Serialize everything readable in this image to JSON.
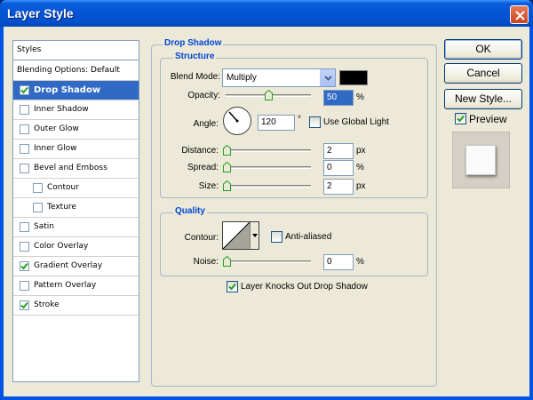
{
  "window": {
    "title": "Layer Style"
  },
  "styles_list": {
    "header": "Styles",
    "blending_label": "Blending Options: Default",
    "items": [
      {
        "label": "Drop Shadow",
        "checked": true,
        "selected": true,
        "indent": false
      },
      {
        "label": "Inner Shadow",
        "checked": false,
        "selected": false,
        "indent": false
      },
      {
        "label": "Outer Glow",
        "checked": false,
        "selected": false,
        "indent": false
      },
      {
        "label": "Inner Glow",
        "checked": false,
        "selected": false,
        "indent": false
      },
      {
        "label": "Bevel and Emboss",
        "checked": false,
        "selected": false,
        "indent": false
      },
      {
        "label": "Contour",
        "checked": false,
        "selected": false,
        "indent": true
      },
      {
        "label": "Texture",
        "checked": false,
        "selected": false,
        "indent": true
      },
      {
        "label": "Satin",
        "checked": false,
        "selected": false,
        "indent": false
      },
      {
        "label": "Color Overlay",
        "checked": false,
        "selected": false,
        "indent": false
      },
      {
        "label": "Gradient Overlay",
        "checked": true,
        "selected": false,
        "indent": false
      },
      {
        "label": "Pattern Overlay",
        "checked": false,
        "selected": false,
        "indent": false
      },
      {
        "label": "Stroke",
        "checked": true,
        "selected": false,
        "indent": false
      }
    ]
  },
  "drop_shadow": {
    "title": "Drop Shadow",
    "structure": {
      "title": "Structure",
      "blend_mode_label": "Blend Mode:",
      "blend_mode_value": "Multiply",
      "shadow_color": "#000000",
      "opacity_label": "Opacity:",
      "opacity_value": "50",
      "opacity_unit": "%",
      "opacity_level": 0.5,
      "angle_label": "Angle:",
      "angle_value": "120",
      "angle_unit": "°",
      "use_global_light_label": "Use Global Light",
      "use_global_light_checked": false,
      "distance_label": "Distance:",
      "distance_value": "2",
      "distance_unit": "px",
      "spread_label": "Spread:",
      "spread_value": "0",
      "spread_unit": "%",
      "size_label": "Size:",
      "size_value": "2",
      "size_unit": "px"
    },
    "quality": {
      "title": "Quality",
      "contour_label": "Contour:",
      "anti_aliased_label": "Anti-aliased",
      "anti_aliased_checked": false,
      "noise_label": "Noise:",
      "noise_value": "0",
      "noise_unit": "%"
    },
    "knocks_out_label": "Layer Knocks Out Drop Shadow",
    "knocks_out_checked": true
  },
  "buttons": {
    "ok": "OK",
    "cancel": "Cancel",
    "new_style": "New Style..."
  },
  "preview": {
    "label": "Preview",
    "checked": true
  },
  "colors": {
    "title_bar": "#0054e3",
    "selection": "#316ac5",
    "dialog_bg": "#ece9d8",
    "group_title": "#0046d5"
  },
  "icons": [
    "close-icon",
    "checkmark-icon",
    "dropdown-arrow-icon",
    "slider-thumb-icon",
    "angle-dial-icon"
  ]
}
